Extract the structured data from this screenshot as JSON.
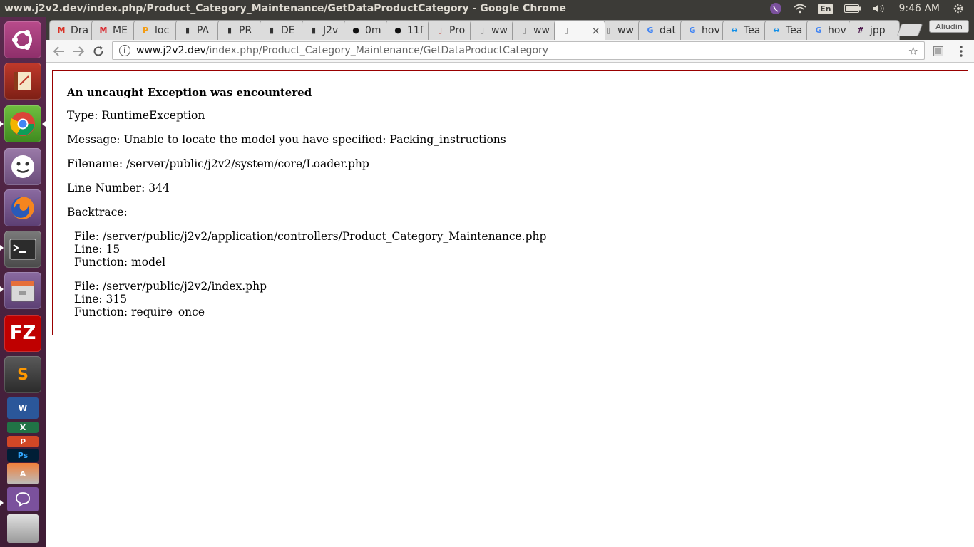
{
  "window": {
    "title": "www.j2v2.dev/index.php/Product_Category_Maintenance/GetDataProductCategory - Google Chrome"
  },
  "indicators": {
    "keyboard": "En",
    "clock": "9:46 AM"
  },
  "tabs": [
    {
      "label": "Dra",
      "icon": "gmail-icon",
      "color": "#d93025"
    },
    {
      "label": "ME",
      "icon": "mega-icon",
      "color": "#d9272e"
    },
    {
      "label": "loc",
      "icon": "phpmyadmin-icon",
      "color": "#f39c12"
    },
    {
      "label": "PA",
      "icon": "trello-icon",
      "color": "#333333"
    },
    {
      "label": "PR",
      "icon": "trello-icon",
      "color": "#333333"
    },
    {
      "label": "DE",
      "icon": "trello-icon",
      "color": "#333333"
    },
    {
      "label": "J2v",
      "icon": "trello-icon",
      "color": "#333333"
    },
    {
      "label": "0m",
      "icon": "github-icon",
      "color": "#111111"
    },
    {
      "label": "11f",
      "icon": "github-icon",
      "color": "#111111"
    },
    {
      "label": "Pro",
      "icon": "page-icon",
      "color": "#c0392b"
    },
    {
      "label": "ww",
      "icon": "page-icon",
      "color": "#666666"
    },
    {
      "label": "ww",
      "icon": "page-icon",
      "color": "#666666"
    },
    {
      "label": "",
      "icon": "page-icon",
      "color": "#666666",
      "active": true,
      "close": "×"
    },
    {
      "label": "ww",
      "icon": "page-icon",
      "color": "#666666"
    },
    {
      "label": "dat",
      "icon": "google-icon",
      "color": "#4285f4"
    },
    {
      "label": "hov",
      "icon": "google-icon",
      "color": "#4285f4"
    },
    {
      "label": "Tea",
      "icon": "teamviewer-icon",
      "color": "#0e8ee9"
    },
    {
      "label": "Tea",
      "icon": "teamviewer-icon",
      "color": "#0e8ee9"
    },
    {
      "label": "hov",
      "icon": "google-icon",
      "color": "#4285f4"
    },
    {
      "label": "jpp",
      "icon": "slack-icon",
      "color": "#4a154b"
    }
  ],
  "profile": "Aliudin",
  "omnibox": {
    "host": "www.j2v2.dev",
    "path": "/index.php/Product_Category_Maintenance/GetDataProductCategory"
  },
  "error": {
    "heading": "An uncaught Exception was encountered",
    "type": "Type: RuntimeException",
    "message": "Message: Unable to locate the model you have specified: Packing_instructions",
    "filename": "Filename: /server/public/j2v2/system/core/Loader.php",
    "line_number": "Line Number: 344",
    "backtrace_label": "Backtrace:",
    "backtrace": [
      {
        "file": "File: /server/public/j2v2/application/controllers/Product_Category_Maintenance.php",
        "line": "Line: 15",
        "function": "Function: model"
      },
      {
        "file": "File: /server/public/j2v2/index.php",
        "line": "Line: 315",
        "function": "Function: require_once"
      }
    ]
  },
  "launcher": [
    {
      "name": "ubuntu-dash-icon"
    },
    {
      "name": "book-app-icon"
    },
    {
      "name": "chrome-icon"
    },
    {
      "name": "pidgin-icon"
    },
    {
      "name": "firefox-icon"
    },
    {
      "name": "terminal-icon"
    },
    {
      "name": "files-icon"
    },
    {
      "name": "filezilla-icon",
      "glyph": "FZ"
    },
    {
      "name": "sublime-text-icon",
      "glyph": "S"
    },
    {
      "name": "word-icon",
      "glyph": "W"
    },
    {
      "name": "excel-icon",
      "glyph": "X"
    },
    {
      "name": "powerpoint-icon",
      "glyph": "P"
    },
    {
      "name": "photoshop-icon",
      "glyph": "Ps"
    },
    {
      "name": "software-center-icon",
      "glyph": "A"
    },
    {
      "name": "viber-icon"
    },
    {
      "name": "scanner-icon"
    }
  ]
}
